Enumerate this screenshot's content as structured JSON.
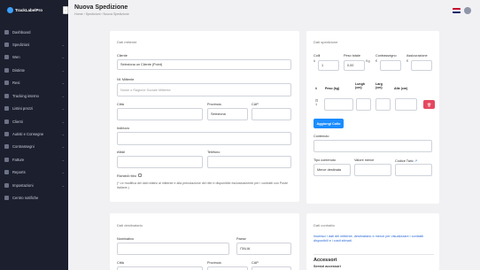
{
  "app": {
    "logo_text": "TrackLabelPro"
  },
  "sidebar": {
    "items": [
      {
        "label": "Dashboard",
        "icon": "home-icon",
        "chevron": false
      },
      {
        "label": "Spedizioni",
        "icon": "box-icon",
        "chevron": true
      },
      {
        "label": "Wen",
        "icon": "shop-icon",
        "chevron": true
      },
      {
        "label": "Distinte",
        "icon": "list-icon",
        "chevron": true
      },
      {
        "label": "Resi",
        "icon": "return-icon",
        "chevron": true
      },
      {
        "label": "Tracking interno",
        "icon": "truck-icon",
        "chevron": true
      },
      {
        "label": "Listini prezzi",
        "icon": "tag-icon",
        "chevron": true
      },
      {
        "label": "Clienti",
        "icon": "users-icon",
        "chevron": true
      },
      {
        "label": "Autisti e Consegne",
        "icon": "driver-icon",
        "chevron": true
      },
      {
        "label": "Contrassegni",
        "icon": "money-icon",
        "chevron": true
      },
      {
        "label": "Fatture",
        "icon": "invoice-icon",
        "chevron": true
      },
      {
        "label": "Reports",
        "icon": "chart-icon",
        "chevron": true
      },
      {
        "label": "Impostazioni",
        "icon": "gear-icon",
        "chevron": true
      },
      {
        "label": "Centro notifiche",
        "icon": "bell-icon",
        "chevron": false
      }
    ]
  },
  "header": {
    "title": "Nuova Spedizione",
    "breadcrumb": "Home  ›  Spedizioni  ›  Nuova Spedizione",
    "collapse_glyph": "‹"
  },
  "mittente": {
    "section_title": "Dati mittente",
    "cliente_label": "Cliente",
    "cliente_value": "Seleziona un Cliente (Point)",
    "nome_label": "Nf. Mittente",
    "nome_placeholder": "Nome o Ragione Sociale Mittente",
    "citta_label": "Città",
    "provincia_label": "Provincia",
    "provincia_value": "Seleziona",
    "cap_label": "CAP",
    "indirizzo_label": "Indirizzo",
    "email_label": "eMail",
    "telefono_label": "Telefono",
    "ritiro_label": "Richiedi ritiro",
    "note": "(* Le modifica dei dati relativi al mittente e alla prenotazione del ritiri è disponibile esclusivamente per i contratti con Poste Italiane.)"
  },
  "spedizione": {
    "section_title": "Dati spedizione",
    "colli_label": "Colli",
    "colli_value": "1",
    "colli_prefix": "#",
    "peso_label": "Peso totale",
    "peso_value": "0,00",
    "peso_unit": "Kg",
    "contrassegno_label": "Contrassegno",
    "contrassegno_prefix": "€",
    "assicurazione_label": "Assicurazione",
    "assicurazione_prefix": "€",
    "table_headers": [
      "#",
      "Peso (kg)",
      "Lungh (cm)",
      "Larg (cm)",
      "Alte (cm)"
    ],
    "row_index": "1",
    "row_icon": "box-icon",
    "delete_glyph": "🗑",
    "add_button": "Aggiungi Collo",
    "contenuto_label": "Contenuto",
    "tipo_label": "Tipo contenuto",
    "tipo_value": "Merce destinata",
    "valore_label": "Valore merce",
    "codice_label": "Codice Taric",
    "codice_badge": "↗"
  },
  "destinatario": {
    "section_title": "Dati destinatario",
    "nominativo_label": "Nominativo",
    "paese_label": "Paese",
    "paese_value": "ITALIA",
    "citta_label": "Città",
    "provincia_label": "Provincia",
    "cap_label": "CAP"
  },
  "contratto": {
    "section_title": "Dati contratto",
    "info_text": "Inserisci i dati del mittente, destinatario e merce per visualizzare i contratti disponibili e i costi stimati.",
    "accessori_title": "Accessori",
    "servizi_label": "Servizi accessori"
  }
}
